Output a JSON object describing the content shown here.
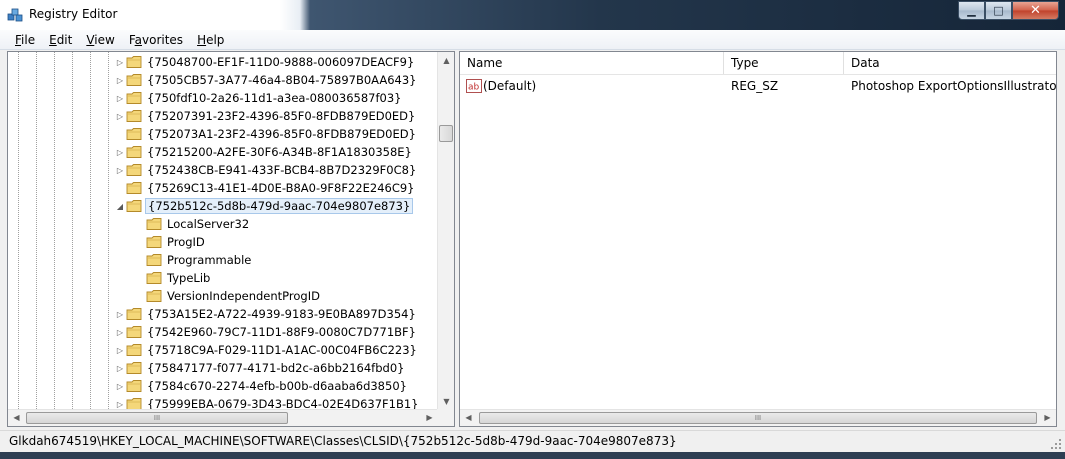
{
  "window": {
    "title": "Registry Editor",
    "caption_buttons": {
      "minimize": "▁",
      "maximize": "□",
      "close": "✕"
    }
  },
  "menubar": [
    {
      "label": "File",
      "accel": "F",
      "rest": "ile"
    },
    {
      "label": "Edit",
      "accel": "E",
      "rest": "dit"
    },
    {
      "label": "View",
      "accel": "V",
      "rest": "iew"
    },
    {
      "label": "Favorites",
      "accel": "a",
      "pre": "F",
      "rest": "vorites"
    },
    {
      "label": "Help",
      "accel": "H",
      "rest": "elp"
    }
  ],
  "tree": {
    "nodes": [
      {
        "label": "{75048700-EF1F-11D0-9888-006097DEACF9}",
        "level": 0,
        "expander": "collapsed"
      },
      {
        "label": "{7505CB57-3A77-46a4-8B04-75897B0AA643}",
        "level": 0,
        "expander": "collapsed"
      },
      {
        "label": "{750fdf10-2a26-11d1-a3ea-080036587f03}",
        "level": 0,
        "expander": "collapsed"
      },
      {
        "label": "{75207391-23F2-4396-85F0-8FDB879ED0ED}",
        "level": 0,
        "expander": "collapsed"
      },
      {
        "label": "{752073A1-23F2-4396-85F0-8FDB879ED0ED}",
        "level": 0,
        "expander": "none"
      },
      {
        "label": "{75215200-A2FE-30F6-A34B-8F1A1830358E}",
        "level": 0,
        "expander": "collapsed"
      },
      {
        "label": "{752438CB-E941-433F-BCB4-8B7D2329F0C8}",
        "level": 0,
        "expander": "collapsed"
      },
      {
        "label": "{75269C13-41E1-4D0E-B8A0-9F8F22E246C9}",
        "level": 0,
        "expander": "none"
      },
      {
        "label": "{752b512c-5d8b-479d-9aac-704e9807e873}",
        "level": 0,
        "expander": "expanded",
        "selected": true
      },
      {
        "label": "LocalServer32",
        "level": 1,
        "expander": "none"
      },
      {
        "label": "ProgID",
        "level": 1,
        "expander": "none"
      },
      {
        "label": "Programmable",
        "level": 1,
        "expander": "none"
      },
      {
        "label": "TypeLib",
        "level": 1,
        "expander": "none"
      },
      {
        "label": "VersionIndependentProgID",
        "level": 1,
        "expander": "none"
      },
      {
        "label": "{753A15E2-A722-4939-9183-9E0BA897D354}",
        "level": 0,
        "expander": "collapsed"
      },
      {
        "label": "{7542E960-79C7-11D1-88F9-0080C7D771BF}",
        "level": 0,
        "expander": "collapsed"
      },
      {
        "label": "{75718C9A-F029-11D1-A1AC-00C04FB6C223}",
        "level": 0,
        "expander": "collapsed"
      },
      {
        "label": "{75847177-f077-4171-bd2c-a6bb2164fbd0}",
        "level": 0,
        "expander": "collapsed"
      },
      {
        "label": "{7584c670-2274-4efb-b00b-d6aaba6d3850}",
        "level": 0,
        "expander": "collapsed"
      },
      {
        "label": "{75999EBA-0679-3D43-BDC4-02E4D637F1B1}",
        "level": 0,
        "expander": "collapsed"
      }
    ]
  },
  "values": {
    "columns": {
      "name": "Name",
      "type": "Type",
      "data": "Data"
    },
    "rows": [
      {
        "name": "(Default)",
        "type": "REG_SZ",
        "data": "Photoshop ExportOptionsIllustrator",
        "icon": "string-value-icon"
      }
    ]
  },
  "scrollbars": {
    "thumb_grip": "III",
    "arrow_up": "▲",
    "arrow_down": "▼",
    "arrow_left": "◀",
    "arrow_right": "▶"
  },
  "statusbar": {
    "path": "Glkdah674519\\HKEY_LOCAL_MACHINE\\SOFTWARE\\Classes\\CLSID\\{752b512c-5d8b-479d-9aac-704e9807e873}"
  },
  "colors": {
    "selection_bg": "#e4effa",
    "selection_border": "#a8c8ea",
    "folder": "#e8c25a"
  }
}
